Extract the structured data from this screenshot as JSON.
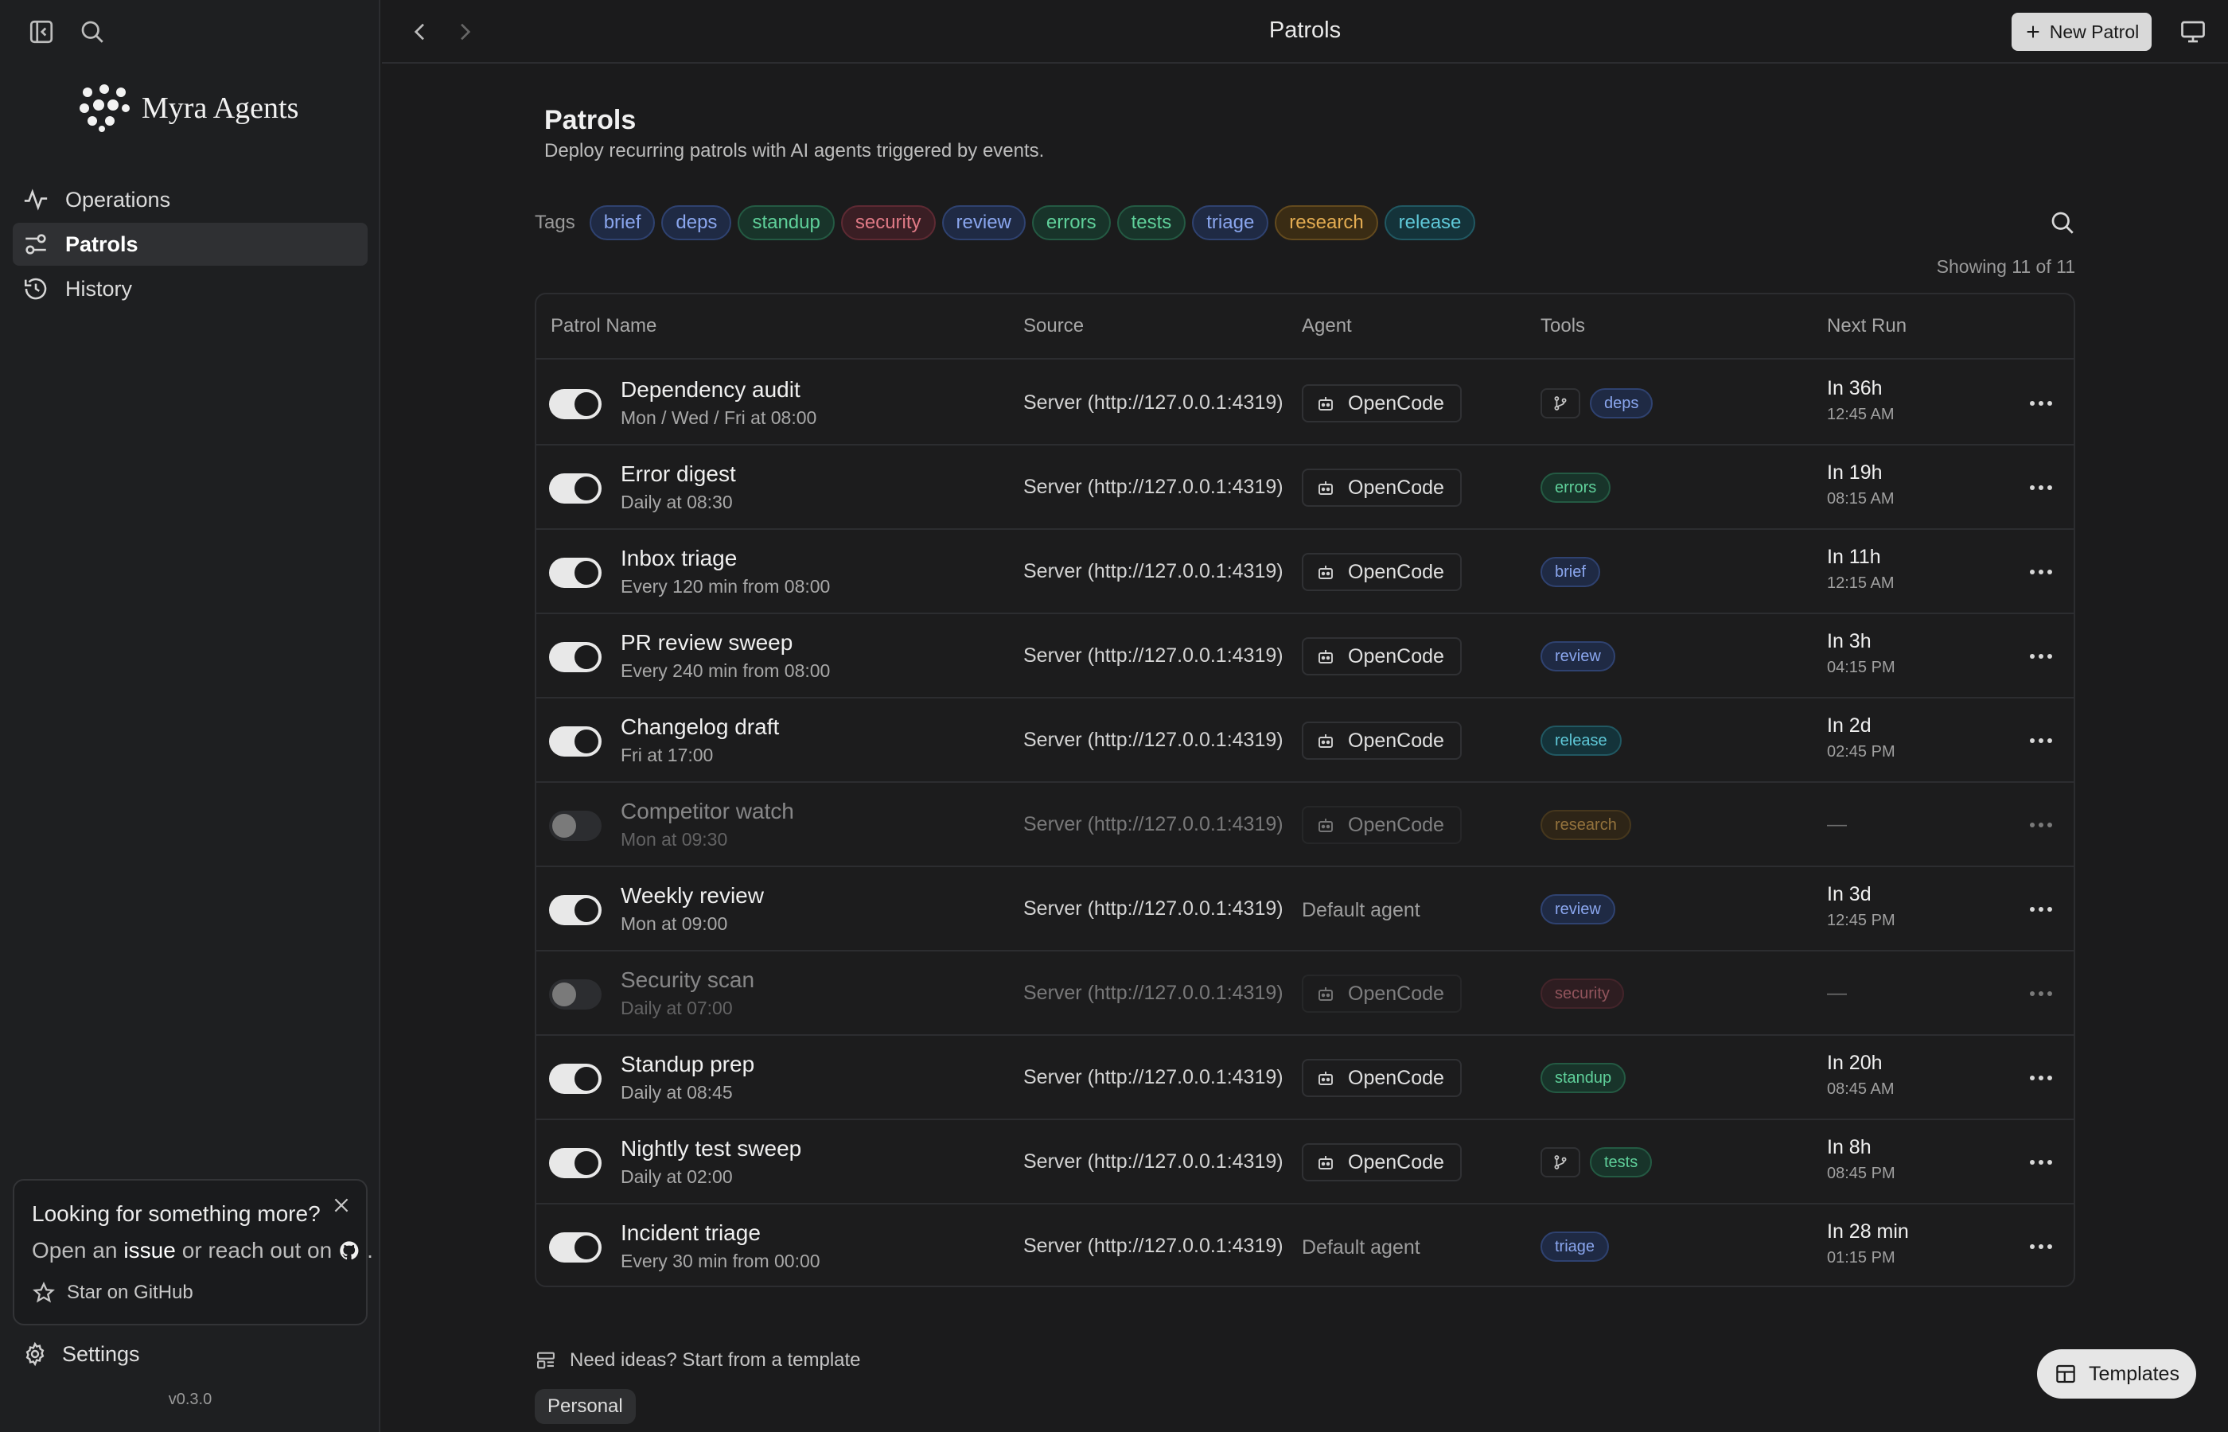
{
  "app": {
    "name": "Myra Agents",
    "version": "v0.3.0"
  },
  "sidebar": {
    "items": [
      {
        "label": "Operations",
        "icon": "activity-icon"
      },
      {
        "label": "Patrols",
        "icon": "sliders-icon",
        "active": true
      },
      {
        "label": "History",
        "icon": "history-icon"
      }
    ],
    "promo": {
      "title": "Looking for something more?",
      "line_prefix": "Open an",
      "line_link": "issue",
      "line_middle": "or reach out on",
      "line_suffix": ".",
      "star_label": "Star on GitHub"
    },
    "settings_label": "Settings"
  },
  "topbar": {
    "title": "Patrols",
    "new_button": "New Patrol"
  },
  "main": {
    "title": "Patrols",
    "subtitle": "Deploy recurring patrols with AI agents triggered by events.",
    "tags_label": "Tags",
    "showing": "Showing 11 of 11",
    "ideas_label": "Need ideas? Start from a template",
    "personal_label": "Personal",
    "templates_button": "Templates"
  },
  "tags": [
    {
      "label": "brief",
      "color": "#8aa6ee",
      "bg": "#1f2a44",
      "border": "#2f4270"
    },
    {
      "label": "deps",
      "color": "#8aa6ee",
      "bg": "#1f2a44",
      "border": "#2f4270"
    },
    {
      "label": "standup",
      "color": "#5fd09a",
      "bg": "#18342a",
      "border": "#245a43"
    },
    {
      "label": "security",
      "color": "#e07a86",
      "bg": "#3a1e24",
      "border": "#5e2a33"
    },
    {
      "label": "review",
      "color": "#8aa6ee",
      "bg": "#1f2a44",
      "border": "#2f4270"
    },
    {
      "label": "errors",
      "color": "#5fd09a",
      "bg": "#18342a",
      "border": "#245a43"
    },
    {
      "label": "tests",
      "color": "#5fd09a",
      "bg": "#18342a",
      "border": "#245a43"
    },
    {
      "label": "triage",
      "color": "#8aa6ee",
      "bg": "#1f2a44",
      "border": "#2f4270"
    },
    {
      "label": "research",
      "color": "#e3ac52",
      "bg": "#3a2c14",
      "border": "#634a1e"
    },
    {
      "label": "release",
      "color": "#5fc8d8",
      "bg": "#14333a",
      "border": "#215862"
    }
  ],
  "table": {
    "headers": {
      "name": "Patrol Name",
      "source": "Source",
      "agent": "Agent",
      "tools": "Tools",
      "next": "Next Run"
    },
    "rows": [
      {
        "name": "Dependency audit",
        "schedule": "Mon / Wed / Fri at 08:00",
        "source": "Server (http://127.0.0.1:4319)",
        "agent": "OpenCode",
        "agent_is_default": false,
        "git_tool": true,
        "tag": "deps",
        "tag_color": "#8aa6ee",
        "tag_bg": "#1f2a44",
        "tag_border": "#2f4270",
        "next_main": "In 36h",
        "next_time": "12:45 AM",
        "enabled": true
      },
      {
        "name": "Error digest",
        "schedule": "Daily at 08:30",
        "source": "Server (http://127.0.0.1:4319)",
        "agent": "OpenCode",
        "agent_is_default": false,
        "git_tool": false,
        "tag": "errors",
        "tag_color": "#5fd09a",
        "tag_bg": "#18342a",
        "tag_border": "#245a43",
        "next_main": "In 19h",
        "next_time": "08:15 AM",
        "enabled": true
      },
      {
        "name": "Inbox triage",
        "schedule": "Every 120 min from 08:00",
        "source": "Server (http://127.0.0.1:4319)",
        "agent": "OpenCode",
        "agent_is_default": false,
        "git_tool": false,
        "tag": "brief",
        "tag_color": "#8aa6ee",
        "tag_bg": "#1f2a44",
        "tag_border": "#2f4270",
        "next_main": "In 11h",
        "next_time": "12:15 AM",
        "enabled": true
      },
      {
        "name": "PR review sweep",
        "schedule": "Every 240 min from 08:00",
        "source": "Server (http://127.0.0.1:4319)",
        "agent": "OpenCode",
        "agent_is_default": false,
        "git_tool": false,
        "tag": "review",
        "tag_color": "#8aa6ee",
        "tag_bg": "#1f2a44",
        "tag_border": "#2f4270",
        "next_main": "In 3h",
        "next_time": "04:15 PM",
        "enabled": true
      },
      {
        "name": "Changelog draft",
        "schedule": "Fri at 17:00",
        "source": "Server (http://127.0.0.1:4319)",
        "agent": "OpenCode",
        "agent_is_default": false,
        "git_tool": false,
        "tag": "release",
        "tag_color": "#5fc8d8",
        "tag_bg": "#14333a",
        "tag_border": "#215862",
        "next_main": "In 2d",
        "next_time": "02:45 PM",
        "enabled": true
      },
      {
        "name": "Competitor watch",
        "schedule": "Mon at 09:30",
        "source": "Server (http://127.0.0.1:4319)",
        "agent": "OpenCode",
        "agent_is_default": false,
        "git_tool": false,
        "tag": "research",
        "tag_color": "#e3ac52",
        "tag_bg": "#3a2c14",
        "tag_border": "#634a1e",
        "next_main": "—",
        "next_time": "",
        "enabled": false
      },
      {
        "name": "Weekly review",
        "schedule": "Mon at 09:00",
        "source": "Server (http://127.0.0.1:4319)",
        "agent": "Default agent",
        "agent_is_default": true,
        "git_tool": false,
        "tag": "review",
        "tag_color": "#8aa6ee",
        "tag_bg": "#1f2a44",
        "tag_border": "#2f4270",
        "next_main": "In 3d",
        "next_time": "12:45 PM",
        "enabled": true
      },
      {
        "name": "Security scan",
        "schedule": "Daily at 07:00",
        "source": "Server (http://127.0.0.1:4319)",
        "agent": "OpenCode",
        "agent_is_default": false,
        "git_tool": false,
        "tag": "security",
        "tag_color": "#e07a86",
        "tag_bg": "#3a1e24",
        "tag_border": "#5e2a33",
        "next_main": "—",
        "next_time": "",
        "enabled": false
      },
      {
        "name": "Standup prep",
        "schedule": "Daily at 08:45",
        "source": "Server (http://127.0.0.1:4319)",
        "agent": "OpenCode",
        "agent_is_default": false,
        "git_tool": false,
        "tag": "standup",
        "tag_color": "#5fd09a",
        "tag_bg": "#18342a",
        "tag_border": "#245a43",
        "next_main": "In 20h",
        "next_time": "08:45 AM",
        "enabled": true
      },
      {
        "name": "Nightly test sweep",
        "schedule": "Daily at 02:00",
        "source": "Server (http://127.0.0.1:4319)",
        "agent": "OpenCode",
        "agent_is_default": false,
        "git_tool": true,
        "tag": "tests",
        "tag_color": "#5fd09a",
        "tag_bg": "#18342a",
        "tag_border": "#245a43",
        "next_main": "In 8h",
        "next_time": "08:45 PM",
        "enabled": true
      },
      {
        "name": "Incident triage",
        "schedule": "Every 30 min from 00:00",
        "source": "Server (http://127.0.0.1:4319)",
        "agent": "Default agent",
        "agent_is_default": true,
        "git_tool": false,
        "tag": "triage",
        "tag_color": "#8aa6ee",
        "tag_bg": "#1f2a44",
        "tag_border": "#2f4270",
        "next_main": "In 28 min",
        "next_time": "01:15 PM",
        "enabled": true
      }
    ]
  }
}
